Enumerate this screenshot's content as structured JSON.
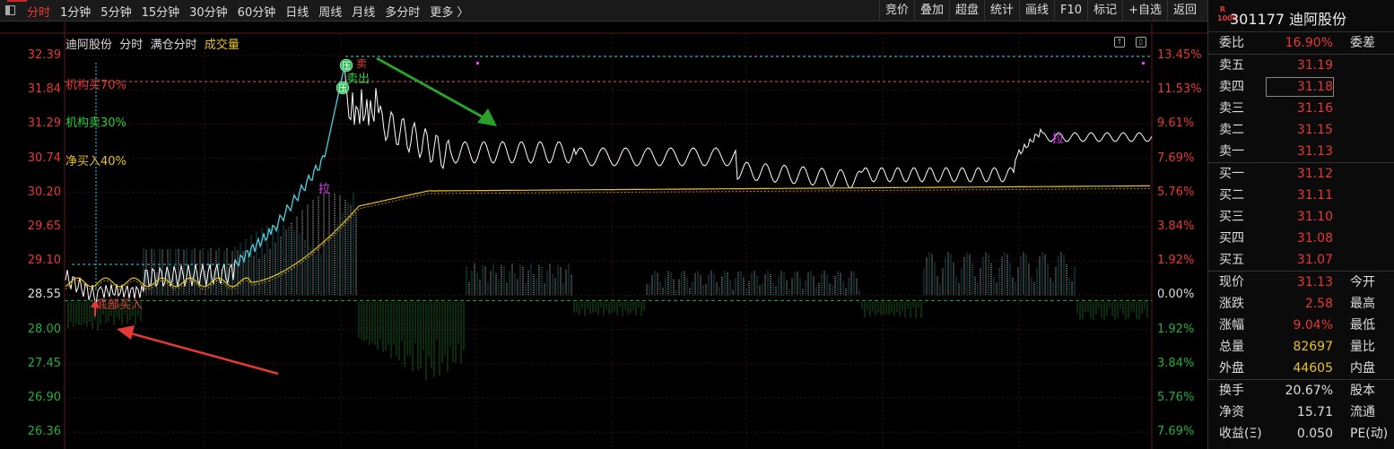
{
  "toolbar": {
    "tabs": [
      "分时",
      "1分钟",
      "5分钟",
      "15分钟",
      "30分钟",
      "60分钟",
      "日线",
      "周线",
      "月线",
      "多分时",
      "更多 〉"
    ],
    "active_tab": 0,
    "tools": [
      "竞价",
      "叠加",
      "超盘",
      "统计",
      "画线",
      "F10",
      "标记",
      "+自选",
      "返回"
    ]
  },
  "chart": {
    "title_name": "迪阿股份",
    "title_mode": "分时",
    "title_overlay": "满仓分时",
    "title_vol": "成交量",
    "price_labels": [
      "32.39",
      "31.84",
      "31.29",
      "30.74",
      "30.20",
      "29.65",
      "29.10",
      "28.55",
      "28.00",
      "27.45",
      "26.90",
      "26.36"
    ],
    "pct_labels": [
      "13.45%",
      "11.53%",
      "9.61%",
      "7.69%",
      "5.76%",
      "3.84%",
      "1.92%",
      "0.00%",
      "1.92%",
      "3.84%",
      "5.76%",
      "7.69%"
    ],
    "annotations": {
      "inst_buy": "机构买70%",
      "inst_sell": "机构卖30%",
      "net_buy": "净买入40%",
      "press": "压",
      "sell_out": "卖出",
      "pull": "拉",
      "bottom_buy": "底部买入",
      "top_mark": "卖"
    },
    "colors": {
      "price_line": "#ffffff",
      "avg_line": "#e6c229",
      "up": "#e53935",
      "down": "#23b03a",
      "cyan": "#3fd0e0"
    }
  },
  "side": {
    "code": "301177",
    "name": "迪阿股份",
    "badge": "R\n1000",
    "webi_label": "委比",
    "webi_value": "16.90%",
    "webi_right": "委差",
    "sells": [
      {
        "label": "卖五",
        "price": "31.19"
      },
      {
        "label": "卖四",
        "price": "31.18"
      },
      {
        "label": "卖三",
        "price": "31.16"
      },
      {
        "label": "卖二",
        "price": "31.15"
      },
      {
        "label": "卖一",
        "price": "31.13"
      }
    ],
    "buys": [
      {
        "label": "买一",
        "price": "31.12"
      },
      {
        "label": "买二",
        "price": "31.11"
      },
      {
        "label": "买三",
        "price": "31.10"
      },
      {
        "label": "买四",
        "price": "31.08"
      },
      {
        "label": "买五",
        "price": "31.07"
      }
    ],
    "stats1": [
      {
        "label": "现价",
        "value": "31.13",
        "right": "今开"
      },
      {
        "label": "涨跌",
        "value": "2.58",
        "right": "最高"
      },
      {
        "label": "涨幅",
        "value": "9.04%",
        "right": "最低"
      },
      {
        "label": "总量",
        "value": "82697",
        "right": "量比"
      },
      {
        "label": "外盘",
        "value": "44605",
        "right": "内盘"
      }
    ],
    "stats2": [
      {
        "label": "换手",
        "value": "20.67%",
        "right": "股本"
      },
      {
        "label": "净资",
        "value": "15.71",
        "right": "流通"
      },
      {
        "label": "收益(Ξ)",
        "value": "0.050",
        "right": "PE(动)"
      }
    ]
  }
}
